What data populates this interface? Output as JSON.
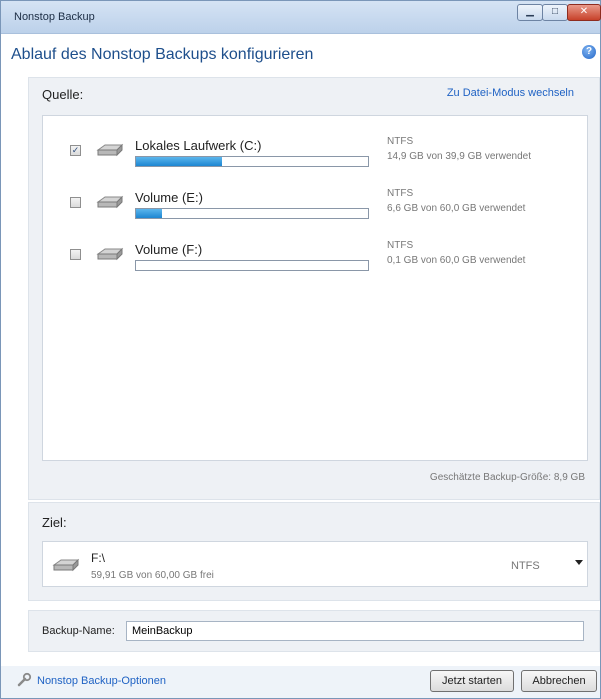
{
  "window": {
    "title": "Nonstop Backup"
  },
  "header": {
    "title": "Ablauf des Nonstop Backups konfigurieren"
  },
  "source": {
    "label": "Quelle:",
    "switch_link": "Zu Datei-Modus wechseln",
    "drives": [
      {
        "name": "Lokales Laufwerk (C:)",
        "filesystem": "NTFS",
        "usage": "14,9 GB von 39,9 GB verwendet",
        "checked": true,
        "fill": 0.37
      },
      {
        "name": "Volume (E:)",
        "filesystem": "NTFS",
        "usage": "6,6 GB von 60,0 GB verwendet",
        "checked": false,
        "fill": 0.11
      },
      {
        "name": "Volume (F:)",
        "filesystem": "NTFS",
        "usage": "0,1 GB von 60,0 GB verwendet",
        "checked": false,
        "fill": 0.002
      }
    ],
    "estimated_size": "Geschätzte Backup-Größe: 8,9 GB"
  },
  "target": {
    "label": "Ziel:",
    "name": "F:\\",
    "free": "59,91 GB von 60,00 GB frei",
    "filesystem": "NTFS"
  },
  "backup_name": {
    "label": "Backup-Name:",
    "value": "MeinBackup"
  },
  "footer": {
    "options_link": "Nonstop Backup-Optionen",
    "start_button": "Jetzt starten",
    "cancel_button": "Abbrechen"
  },
  "colors": {
    "accent": "#1e4f8c",
    "link": "#1f62c4",
    "bar_fill": "#2a93d9"
  }
}
